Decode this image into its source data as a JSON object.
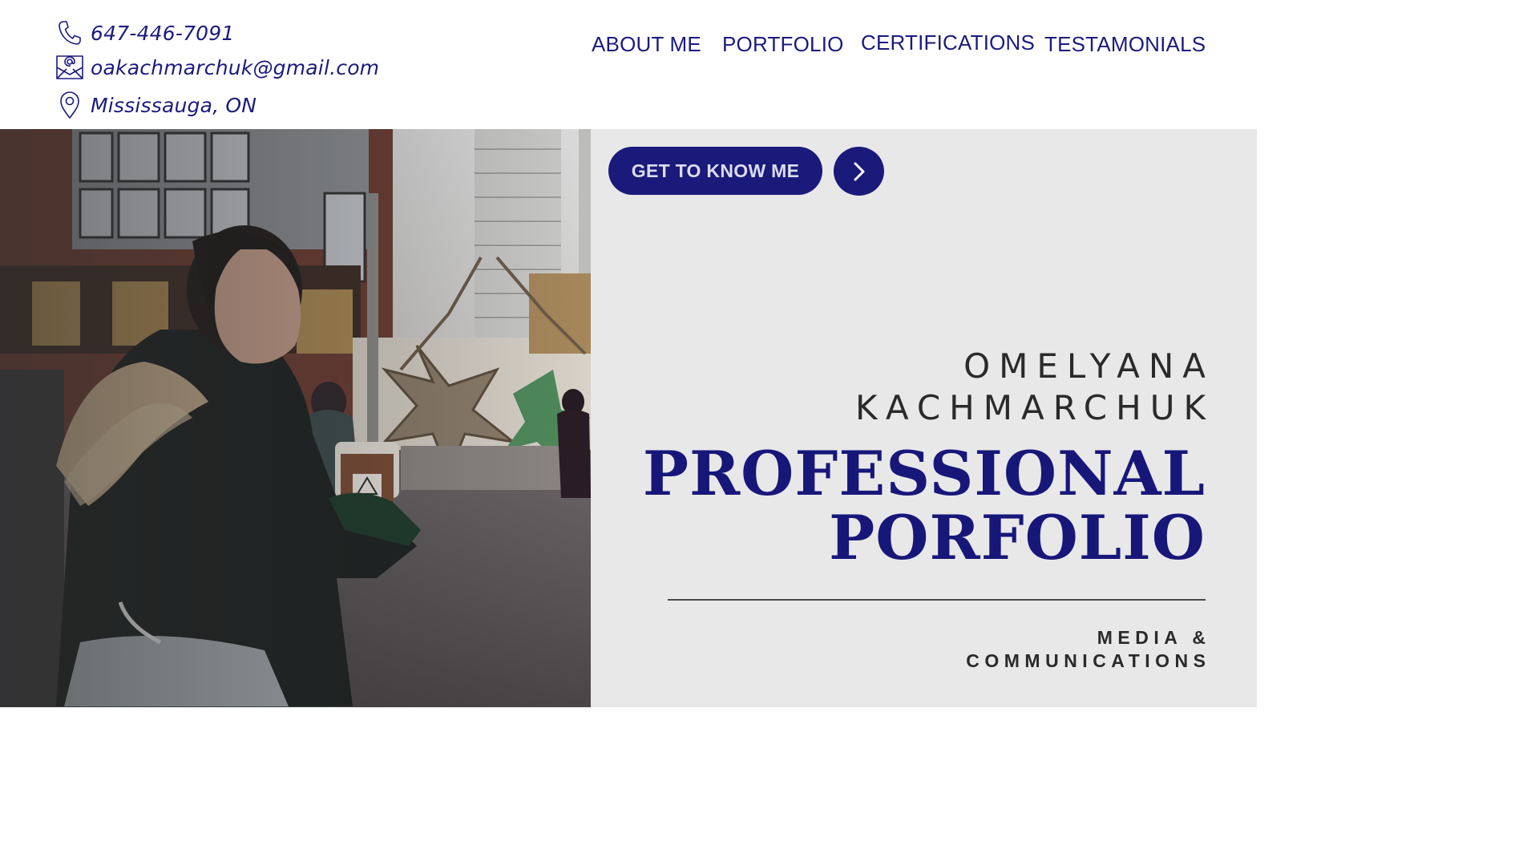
{
  "contact": {
    "phone": "647-446-7091",
    "email": "oakachmarchuk@gmail.com",
    "location": "Mississauga, ON",
    "icons": [
      "phone-icon",
      "email-icon",
      "location-pin-icon"
    ]
  },
  "nav": {
    "items": [
      {
        "label": "ABOUT ME"
      },
      {
        "label": "PORTFOLIO"
      },
      {
        "label": "CERTIFICATIONS"
      },
      {
        "label": "TESTAMONIALS"
      }
    ]
  },
  "hero": {
    "cta_label": "GET TO KNOW ME",
    "cta_icon": "chevron-right-icon",
    "name_first": "OMELYANA",
    "name_last": "KACHMARCHUK",
    "title_line1": "PROFESSIONAL",
    "title_line2": "PORFOLIO",
    "subtitle_line1": "MEDIA &",
    "subtitle_line2": "COMMUNICATIONS"
  },
  "colors": {
    "accent": "#1a1a7a",
    "panel_bg": "#e8e8e9",
    "header_bg": "#ffffff",
    "name_text": "#2a2a2a"
  }
}
